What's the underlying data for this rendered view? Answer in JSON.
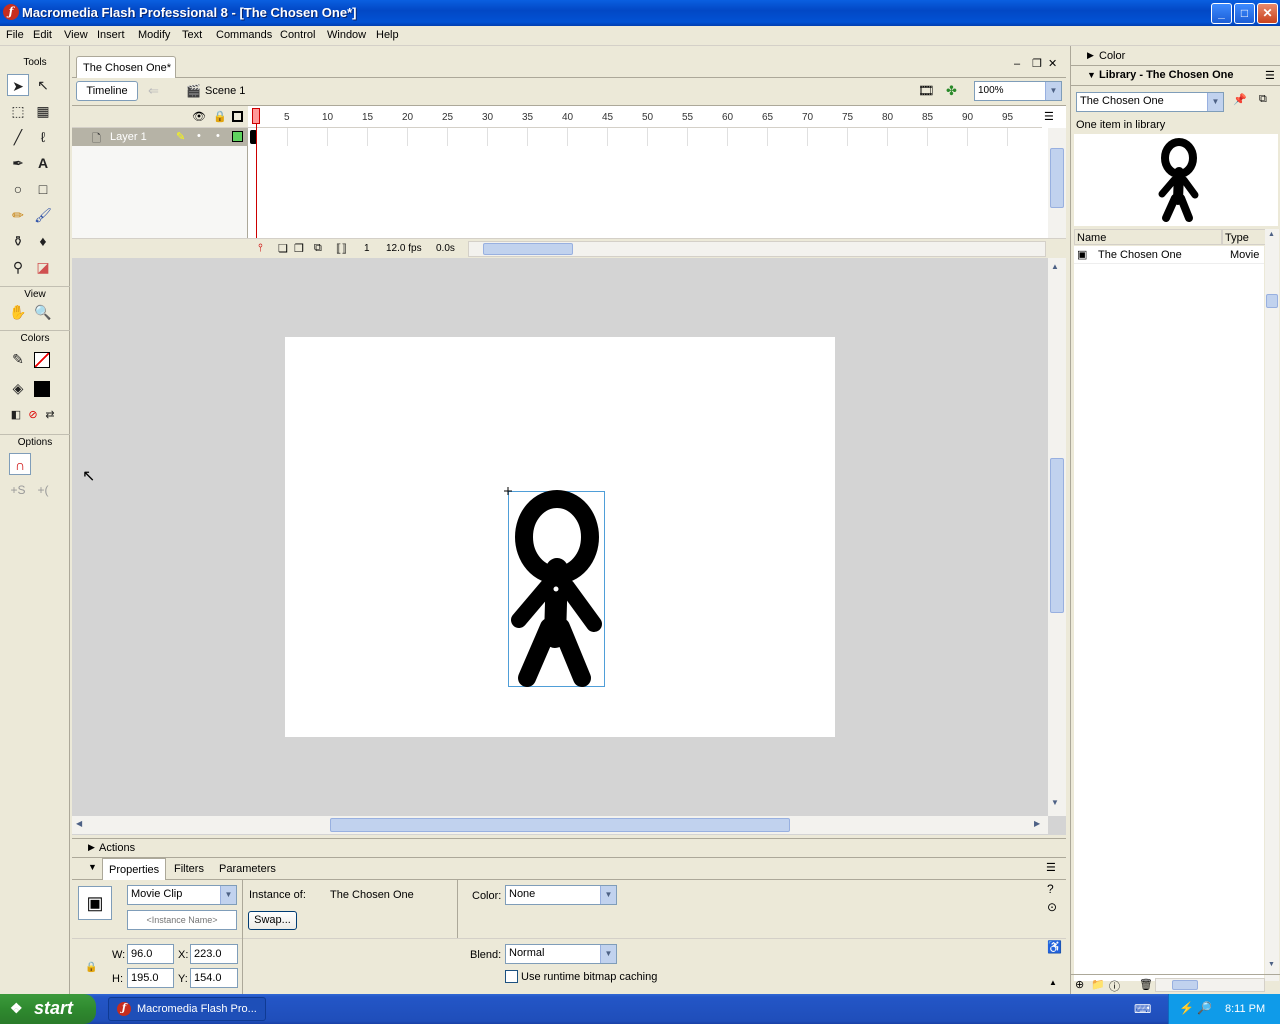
{
  "window": {
    "title": "Macromedia Flash Professional 8 - [The Chosen One*]",
    "app_icon": "flash-logo-icon",
    "min": "_",
    "max": "□",
    "close": "✕"
  },
  "menu": [
    "File",
    "Edit",
    "View",
    "Insert",
    "Modify",
    "Text",
    "Commands",
    "Control",
    "Window",
    "Help"
  ],
  "tools": {
    "title": "Tools",
    "view": "View",
    "colors": "Colors",
    "options": "Options"
  },
  "document": {
    "tab": "The Chosen One*",
    "timeline_button": "Timeline",
    "scene": "Scene 1",
    "zoom": "100%",
    "layer_name": "Layer 1",
    "frame_ticks": [
      "5",
      "10",
      "15",
      "20",
      "25",
      "30",
      "35",
      "40",
      "45",
      "50",
      "55",
      "60",
      "65",
      "70",
      "75",
      "80",
      "85",
      "90",
      "95"
    ],
    "current_frame": "1",
    "fps": "12.0 fps",
    "time": "0.0s"
  },
  "actions_panel": {
    "title": "Actions"
  },
  "properties": {
    "tabs": [
      "Properties",
      "Filters",
      "Parameters"
    ],
    "symbol_type": "Movie Clip",
    "instance_name_placeholder": "<Instance Name>",
    "instance_of_label": "Instance of:",
    "instance_of_value": "The Chosen One",
    "swap": "Swap...",
    "color_label": "Color:",
    "color_value": "None",
    "blend_label": "Blend:",
    "blend_value": "Normal",
    "bitmap_caching": "Use runtime bitmap caching",
    "w_label": "W:",
    "w": "96.0",
    "h_label": "H:",
    "h": "195.0",
    "x_label": "X:",
    "x": "223.0",
    "y_label": "Y:",
    "y": "154.0"
  },
  "right_panels": {
    "color_title": "Color",
    "library_title": "Library - The Chosen One",
    "library_select": "The Chosen One",
    "item_count": "One item in library",
    "col_name": "Name",
    "col_type": "Type",
    "item_name": "The Chosen One",
    "item_type": "Movie"
  },
  "taskbar": {
    "start": "start",
    "task": "Macromedia Flash Pro...",
    "clock": "8:11 PM"
  }
}
